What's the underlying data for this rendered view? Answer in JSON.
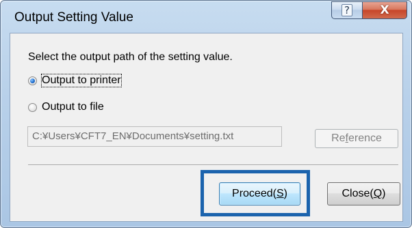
{
  "window": {
    "title": "Output Setting Value",
    "help_glyph": "?",
    "close_glyph": "X"
  },
  "dialog": {
    "instruction": "Select the output path of the setting value.",
    "options": [
      {
        "label": "Output to printer",
        "checked": true
      },
      {
        "label": "Output to file",
        "checked": false
      }
    ],
    "path_value": "C:¥Users¥CFT7_EN¥Documents¥setting.txt",
    "reference_label_pre": "Re",
    "reference_label_u": "f",
    "reference_label_post": "erence",
    "proceed_label_pre": "Proceed(",
    "proceed_label_u": "S",
    "proceed_label_post": ")",
    "close_label_pre": "Close(",
    "close_label_u": "Q",
    "close_label_post": ")"
  },
  "colors": {
    "highlight": "#1b63ad",
    "close_button": "#c7462a"
  },
  "icons": [
    "help-icon",
    "close-icon",
    "radio-checked-icon",
    "radio-unchecked-icon"
  ]
}
